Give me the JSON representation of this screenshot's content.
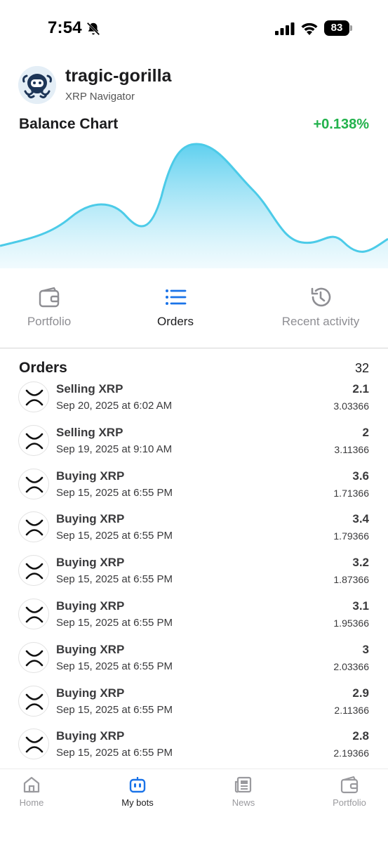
{
  "status_bar": {
    "time": "7:54",
    "battery": "83",
    "icons": [
      "bell-slash-icon",
      "cellular-signal-icon",
      "wifi-icon",
      "battery-icon"
    ]
  },
  "header": {
    "avatar_icon": "octopus-robot-avatar",
    "bot_name": "tragic-gorilla",
    "subtitle": "XRP Navigator"
  },
  "chart": {
    "title": "Balance Chart",
    "change": "+0.138%",
    "change_color": "#22b24c",
    "line_color": "#4ccbe8"
  },
  "tabs": [
    {
      "label": "Portfolio",
      "icon": "wallet-icon",
      "active": false
    },
    {
      "label": "Orders",
      "icon": "list-icon",
      "active": true
    },
    {
      "label": "Recent activity",
      "icon": "history-icon",
      "active": false
    }
  ],
  "orders": {
    "title": "Orders",
    "count": "32",
    "icon": "xrp-icon",
    "items": [
      {
        "title": "Selling XRP",
        "date": "Sep 20, 2025 at 6:02 AM",
        "amount": "2.1",
        "price": "3.03366"
      },
      {
        "title": "Selling XRP",
        "date": "Sep 19, 2025 at 9:10 AM",
        "amount": "2",
        "price": "3.11366"
      },
      {
        "title": "Buying XRP",
        "date": "Sep 15, 2025 at 6:55 PM",
        "amount": "3.6",
        "price": "1.71366"
      },
      {
        "title": "Buying XRP",
        "date": "Sep 15, 2025 at 6:55 PM",
        "amount": "3.4",
        "price": "1.79366"
      },
      {
        "title": "Buying XRP",
        "date": "Sep 15, 2025 at 6:55 PM",
        "amount": "3.2",
        "price": "1.87366"
      },
      {
        "title": "Buying XRP",
        "date": "Sep 15, 2025 at 6:55 PM",
        "amount": "3.1",
        "price": "1.95366"
      },
      {
        "title": "Buying XRP",
        "date": "Sep 15, 2025 at 6:55 PM",
        "amount": "3",
        "price": "2.03366"
      },
      {
        "title": "Buying XRP",
        "date": "Sep 15, 2025 at 6:55 PM",
        "amount": "2.9",
        "price": "2.11366"
      },
      {
        "title": "Buying XRP",
        "date": "Sep 15, 2025 at 6:55 PM",
        "amount": "2.8",
        "price": "2.19366"
      }
    ]
  },
  "bottom_nav": [
    {
      "label": "Home",
      "icon": "home-icon",
      "active": false
    },
    {
      "label": "My bots",
      "icon": "robot-icon",
      "active": true
    },
    {
      "label": "News",
      "icon": "newspaper-icon",
      "active": false
    },
    {
      "label": "Portfolio",
      "icon": "wallet-icon",
      "active": false
    }
  ],
  "colors": {
    "accent": "#1a73e8",
    "active_text": "#1c1c1e",
    "inactive_text": "#8e8e93"
  }
}
